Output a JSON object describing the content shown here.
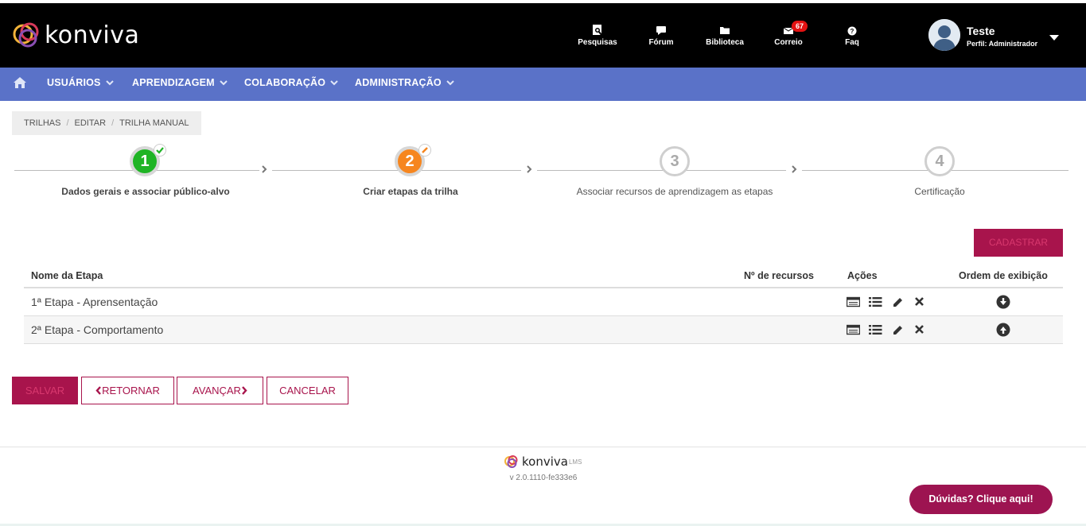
{
  "header": {
    "logo_text": "konviva",
    "nav": [
      {
        "label": "Pesquisas",
        "icon": "survey-icon"
      },
      {
        "label": "Fórum",
        "icon": "chat-icon"
      },
      {
        "label": "Biblioteca",
        "icon": "folder-icon"
      },
      {
        "label": "Correio",
        "icon": "mail-icon",
        "badge": "67"
      },
      {
        "label": "Faq",
        "icon": "question-icon"
      }
    ],
    "user": {
      "name": "Teste",
      "profile": "Perfil: Administrador"
    }
  },
  "menu": {
    "items": [
      {
        "label": "USUÁRIOS"
      },
      {
        "label": "APRENDIZAGEM"
      },
      {
        "label": "COLABORAÇÃO"
      },
      {
        "label": "ADMINISTRAÇÃO"
      }
    ]
  },
  "breadcrumb": [
    "TRILHAS",
    "EDITAR",
    "TRILHA MANUAL"
  ],
  "steps": [
    {
      "number": "1",
      "label": "Dados gerais e associar público-alvo",
      "state": "done"
    },
    {
      "number": "2",
      "label": "Criar etapas da trilha",
      "state": "current"
    },
    {
      "number": "3",
      "label": "Associar recursos de aprendizagem as etapas",
      "state": "todo"
    },
    {
      "number": "4",
      "label": "Certificação",
      "state": "todo"
    }
  ],
  "cadastrar_label": "CADASTRAR",
  "table": {
    "headers": {
      "name": "Nome da Etapa",
      "resources": "Nº de recursos",
      "actions": "Ações",
      "order": "Ordem de exibição"
    },
    "rows": [
      {
        "name": "1ª Etapa - Aprensentação",
        "resources": "",
        "order_icon": "arrow-down-circle-icon"
      },
      {
        "name": "2ª Etapa - Comportamento",
        "resources": "",
        "order_icon": "arrow-up-circle-icon"
      }
    ]
  },
  "buttons": {
    "salvar": "SALVAR",
    "retornar": "RETORNAR",
    "avancar": "AVANÇAR",
    "cancelar": "CANCELAR"
  },
  "footer": {
    "logo_text": "konviva",
    "logo_sup": "LMS",
    "version": "v 2.0.1110-fe333e6",
    "help": "Dúvidas? Clique aqui!"
  },
  "colors": {
    "header_bg": "#000000",
    "menu_bg": "#5a72c8",
    "accent": "#a8144c",
    "step_done": "#1fb425",
    "step_current": "#f6861f"
  }
}
